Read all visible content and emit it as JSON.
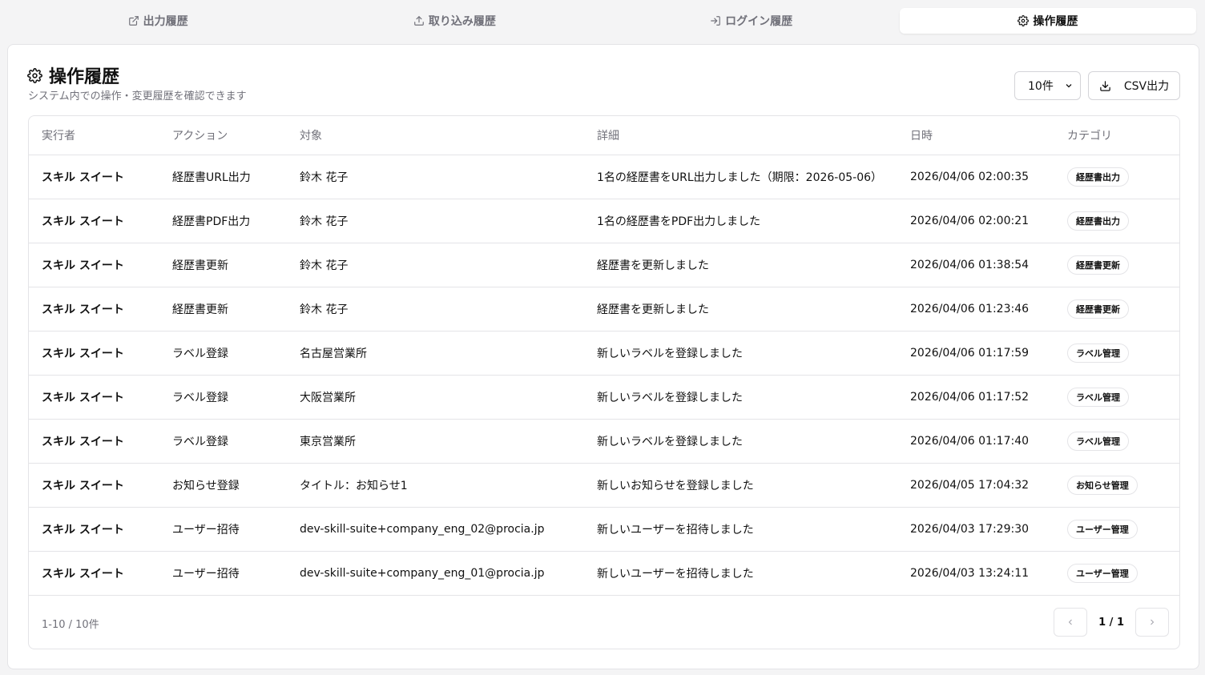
{
  "tabs": [
    {
      "label": "出力履歴",
      "icon": "external-link-icon"
    },
    {
      "label": "取り込み履歴",
      "icon": "upload-icon"
    },
    {
      "label": "ログイン履歴",
      "icon": "login-icon"
    },
    {
      "label": "操作履歴",
      "icon": "gear-icon",
      "active": true
    }
  ],
  "header": {
    "title": "操作履歴",
    "subtitle": "システム内での操作・変更履歴を確認できます",
    "page_size": "10件",
    "csv_label": "CSV出力"
  },
  "table": {
    "columns": [
      "実行者",
      "アクション",
      "対象",
      "詳細",
      "日時",
      "カテゴリ"
    ],
    "rows": [
      {
        "actor": "スキル スイート",
        "action": "経歴書URL出力",
        "target": "鈴木 花子",
        "detail": "1名の経歴書をURL出力しました（期限：2026-05-06）",
        "datetime": "2026/04/06 02:00:35",
        "category": "経歴書出力"
      },
      {
        "actor": "スキル スイート",
        "action": "経歴書PDF出力",
        "target": "鈴木 花子",
        "detail": "1名の経歴書をPDF出力しました",
        "datetime": "2026/04/06 02:00:21",
        "category": "経歴書出力"
      },
      {
        "actor": "スキル スイート",
        "action": "経歴書更新",
        "target": "鈴木 花子",
        "detail": "経歴書を更新しました",
        "datetime": "2026/04/06 01:38:54",
        "category": "経歴書更新"
      },
      {
        "actor": "スキル スイート",
        "action": "経歴書更新",
        "target": "鈴木 花子",
        "detail": "経歴書を更新しました",
        "datetime": "2026/04/06 01:23:46",
        "category": "経歴書更新"
      },
      {
        "actor": "スキル スイート",
        "action": "ラベル登録",
        "target": "名古屋営業所",
        "detail": "新しいラベルを登録しました",
        "datetime": "2026/04/06 01:17:59",
        "category": "ラベル管理"
      },
      {
        "actor": "スキル スイート",
        "action": "ラベル登録",
        "target": "大阪営業所",
        "detail": "新しいラベルを登録しました",
        "datetime": "2026/04/06 01:17:52",
        "category": "ラベル管理"
      },
      {
        "actor": "スキル スイート",
        "action": "ラベル登録",
        "target": "東京営業所",
        "detail": "新しいラベルを登録しました",
        "datetime": "2026/04/06 01:17:40",
        "category": "ラベル管理"
      },
      {
        "actor": "スキル スイート",
        "action": "お知らせ登録",
        "target": "タイトル：お知らせ1",
        "detail": "新しいお知らせを登録しました",
        "datetime": "2026/04/05 17:04:32",
        "category": "お知らせ管理"
      },
      {
        "actor": "スキル スイート",
        "action": "ユーザー招待",
        "target": "dev-skill-suite+company_eng_02@procia.jp",
        "detail": "新しいユーザーを招待しました",
        "datetime": "2026/04/03 17:29:30",
        "category": "ユーザー管理"
      },
      {
        "actor": "スキル スイート",
        "action": "ユーザー招待",
        "target": "dev-skill-suite+company_eng_01@procia.jp",
        "detail": "新しいユーザーを招待しました",
        "datetime": "2026/04/03 13:24:11",
        "category": "ユーザー管理"
      }
    ]
  },
  "footer": {
    "count": "1-10 / 10件",
    "page": "1 / 1"
  }
}
